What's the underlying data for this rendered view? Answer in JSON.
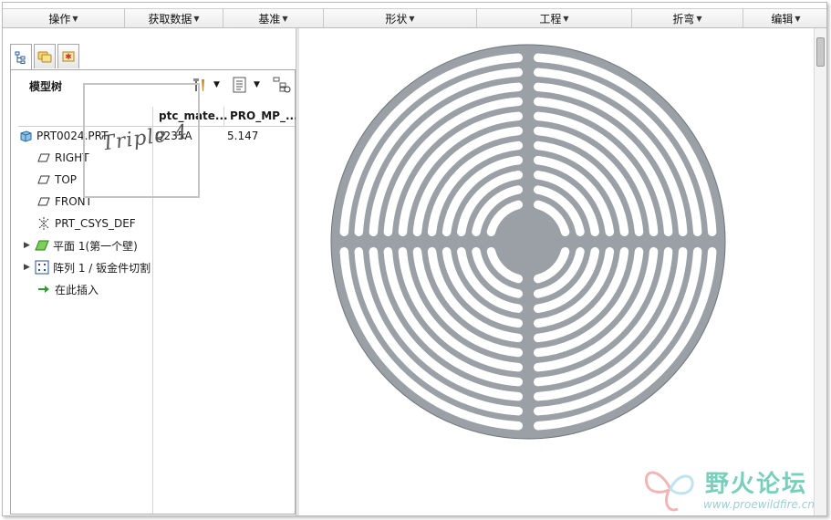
{
  "menu": [
    {
      "label": "操作"
    },
    {
      "label": "获取数据"
    },
    {
      "label": "基准"
    },
    {
      "label": "形状"
    },
    {
      "label": "工程"
    },
    {
      "label": "折弯"
    },
    {
      "label": "编辑"
    }
  ],
  "tabs": [
    {
      "icon": "model-tree-icon"
    },
    {
      "icon": "folder-browser-icon"
    },
    {
      "icon": "favorites-icon"
    }
  ],
  "model_tree": {
    "title": "模型树",
    "columns": [
      "ptc_mate...",
      "PRO_MP_..."
    ],
    "items": [
      {
        "label": "PRT0024.PRT",
        "icon": "part-icon",
        "col1": "Q235A",
        "col2": "5.147",
        "expandable": false
      },
      {
        "label": "RIGHT",
        "icon": "datum-plane-icon",
        "expandable": false
      },
      {
        "label": "TOP",
        "icon": "datum-plane-icon",
        "expandable": false
      },
      {
        "label": "FRONT",
        "icon": "datum-plane-icon",
        "expandable": false
      },
      {
        "label": "PRT_CSYS_DEF",
        "icon": "csys-icon",
        "expandable": false
      },
      {
        "label": "平面 1(第一个壁)",
        "icon": "flat-wall-icon",
        "expandable": true
      },
      {
        "label": "阵列 1 / 钣金件切割",
        "icon": "pattern-icon",
        "expandable": true
      },
      {
        "label": "在此插入",
        "icon": "insert-here-icon",
        "expandable": false
      }
    ]
  },
  "watermark": {
    "text": "Triple 4"
  },
  "logo": {
    "name": "野火论坛",
    "url": "www.proewildfire.cn"
  },
  "colors": {
    "part": "#9aa0a6",
    "part_edge": "#6f757b",
    "logo": "#79cfbc"
  }
}
